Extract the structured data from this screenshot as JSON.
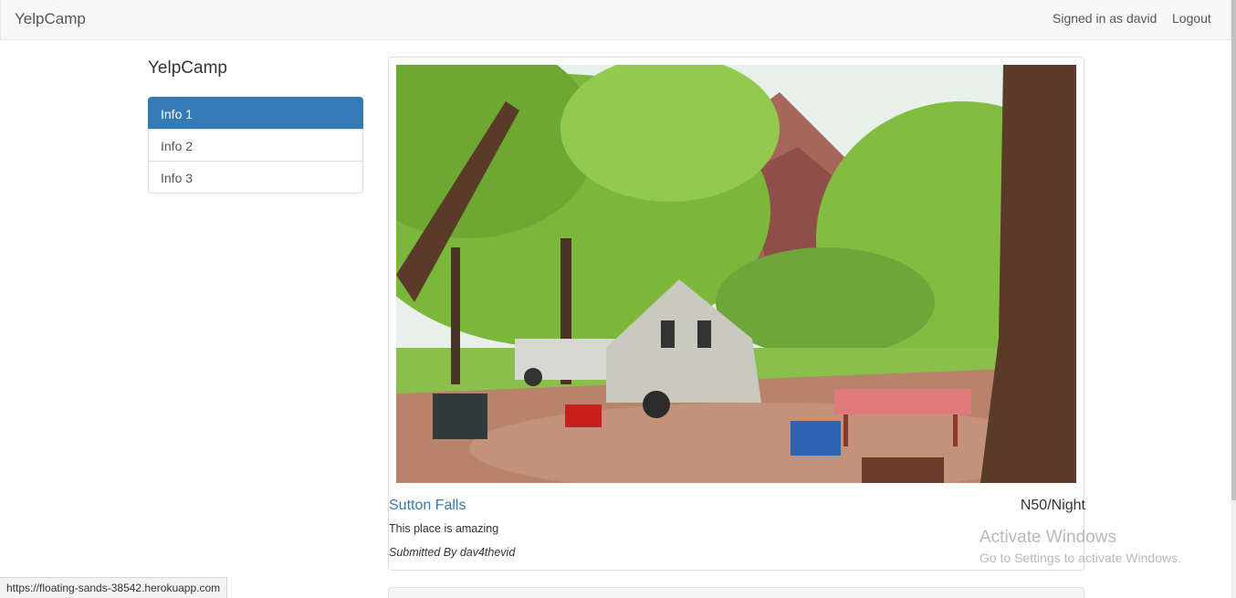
{
  "navbar": {
    "brand": "YelpCamp",
    "signed_in": "Signed in as david",
    "logout": "Logout"
  },
  "sidebar": {
    "title": "YelpCamp",
    "items": [
      {
        "label": "Info 1",
        "active": true
      },
      {
        "label": "Info 2",
        "active": false
      },
      {
        "label": "Info 3",
        "active": false
      }
    ]
  },
  "campground": {
    "name": "Sutton Falls",
    "price": "N50/Night",
    "description": "This place is amazing",
    "author": "Submitted By dav4thevid"
  },
  "watermark": {
    "title": "Activate Windows",
    "subtitle": "Go to Settings to activate Windows."
  },
  "status_bar": {
    "url": "https://floating-sands-38542.herokuapp.com"
  },
  "colors": {
    "accent": "#337ab7",
    "navbar_bg": "#f8f8f8"
  }
}
